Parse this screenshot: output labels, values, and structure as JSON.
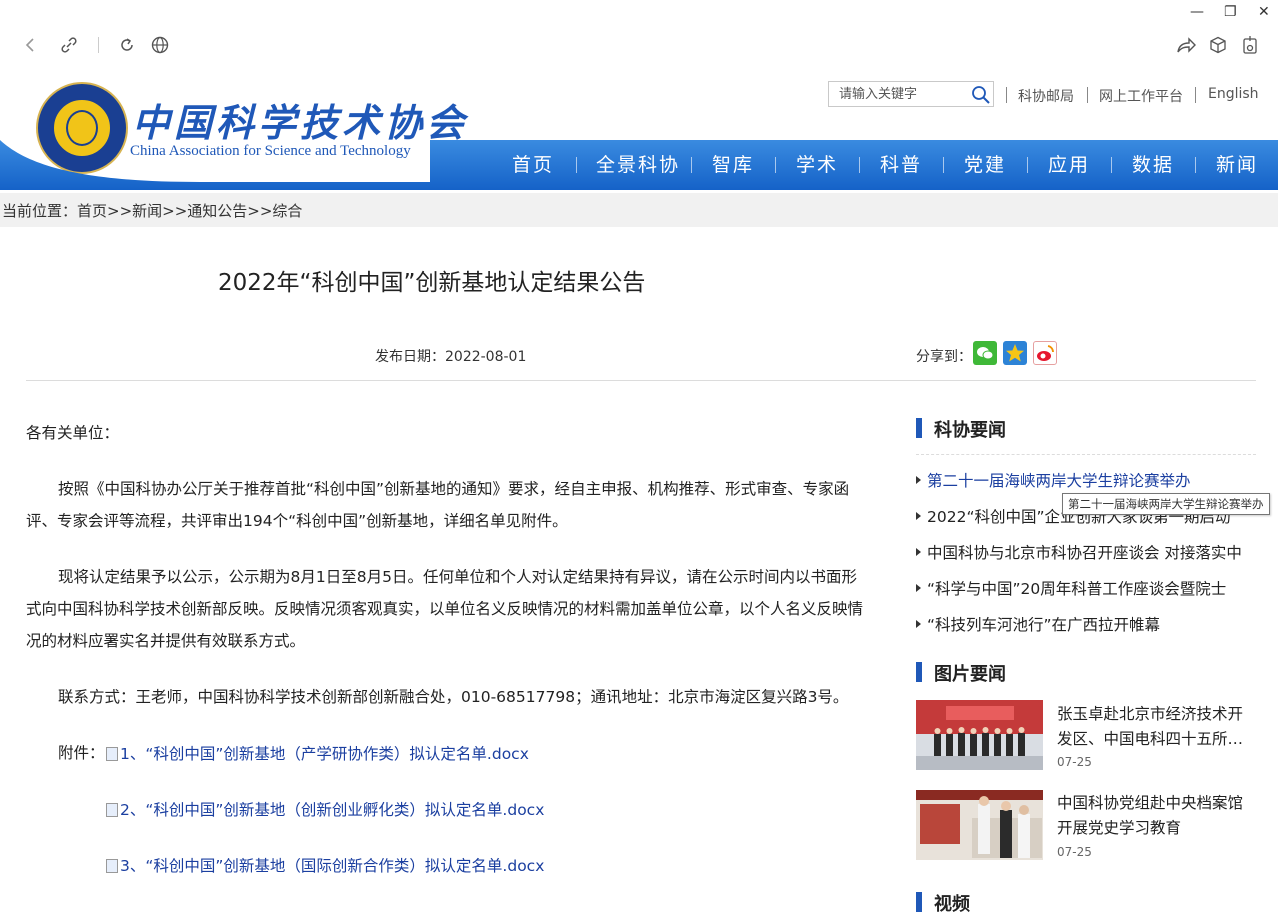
{
  "window": {
    "minimize": "—",
    "restore": "❐",
    "close": "✕"
  },
  "header": {
    "logo_cn": "中国科学技术协会",
    "logo_en": "China Association for Science and Technology",
    "search_placeholder": "请输入关键字",
    "links": [
      "科协邮局",
      "网上工作平台",
      "English"
    ]
  },
  "nav": {
    "items": [
      "首页",
      "全景科协",
      "智库",
      "学术",
      "科普",
      "党建",
      "应用",
      "数据",
      "新闻"
    ]
  },
  "breadcrumb": "当前位置：首页>>新闻>>通知公告>>综合",
  "article": {
    "title": "2022年“科创中国”创新基地认定结果公告",
    "pubdate": "发布日期：2022-08-01",
    "share_label": "分享到：",
    "salutation": "各有关单位：",
    "para1": "按照《中国科协办公厅关于推荐首批“科创中国”创新基地的通知》要求，经自主申报、机构推荐、形式审查、专家函评、专家会评等流程，共评审出194个“科创中国”创新基地，详细名单见附件。",
    "para2": "现将认定结果予以公示，公示期为8月1日至8月5日。任何单位和个人对认定结果持有异议，请在公示时间内以书面形式向中国科协科学技术创新部反映。反映情况须客观真实，以单位名义反映情况的材料需加盖单位公章，以个人名义反映情况的材料应署实名并提供有效联系方式。",
    "contact": "联系方式：王老师，中国科协科学技术创新部创新融合处，010-68517798；通讯地址：北京市海淀区复兴路3号。",
    "attach_label": "附件：",
    "attachments": [
      "1、“科创中国”创新基地（产学研协作类）拟认定名单.docx",
      "2、“科创中国”创新基地（创新创业孵化类）拟认定名单.docx",
      "3、“科创中国”创新基地（国际创新合作类）拟认定名单.docx"
    ]
  },
  "sidebar": {
    "news_heading": "科协要闻",
    "news": [
      "第二十一届海峡两岸大学生辩论赛举办",
      "2022“科创中国”企业创新大家谈第一期启动",
      "中国科协与北京市科协召开座谈会 对接落实中",
      "“科学与中国”20周年科普工作座谈会暨院士",
      "“科技列车河池行”在广西拉开帷幕"
    ],
    "tooltip": "第二十一届海峡两岸大学生辩论赛举办",
    "pics_heading": "图片要闻",
    "pics": [
      {
        "title": "张玉卓赴北京市经济技术开发区、中国电科四十五所…",
        "date": "07-25"
      },
      {
        "title": "中国科协党组赴中央档案馆开展党史学习教育",
        "date": "07-25"
      }
    ],
    "video_heading": "视频"
  }
}
